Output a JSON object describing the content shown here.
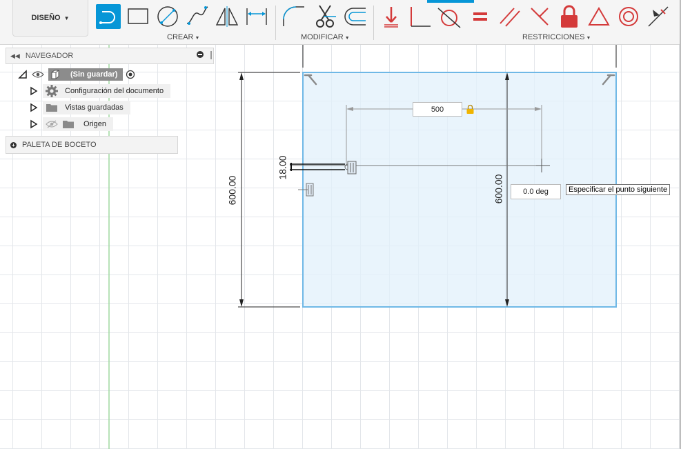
{
  "toolbar": {
    "design_label": "DISEÑO",
    "groups": {
      "create": "CREAR",
      "modify": "MODIFICAR",
      "constraints": "RESTRICCIONES"
    }
  },
  "browser": {
    "title": "NAVEGADOR",
    "root": "(Sin guardar)",
    "items": [
      {
        "label": "Configuración del documento",
        "icon": "gear-icon"
      },
      {
        "label": "Vistas guardadas",
        "icon": "folder-icon"
      },
      {
        "label": "Origen",
        "icon": "folder-icon"
      }
    ]
  },
  "sketch_palette": {
    "title": "PALETA DE BOCETO"
  },
  "canvas": {
    "length_input": "500",
    "angle_input": "0.0 deg",
    "tooltip": "Especificar el punto siguiente",
    "dim_height_left": "600.00",
    "dim_height_right": "600.00",
    "dim_small": "18.00"
  },
  "colors": {
    "accent": "#0696d7",
    "constraint_red": "#d43a3a",
    "sketch_fill": "#e2f0fb",
    "sketch_edge": "#6fb8e6"
  }
}
